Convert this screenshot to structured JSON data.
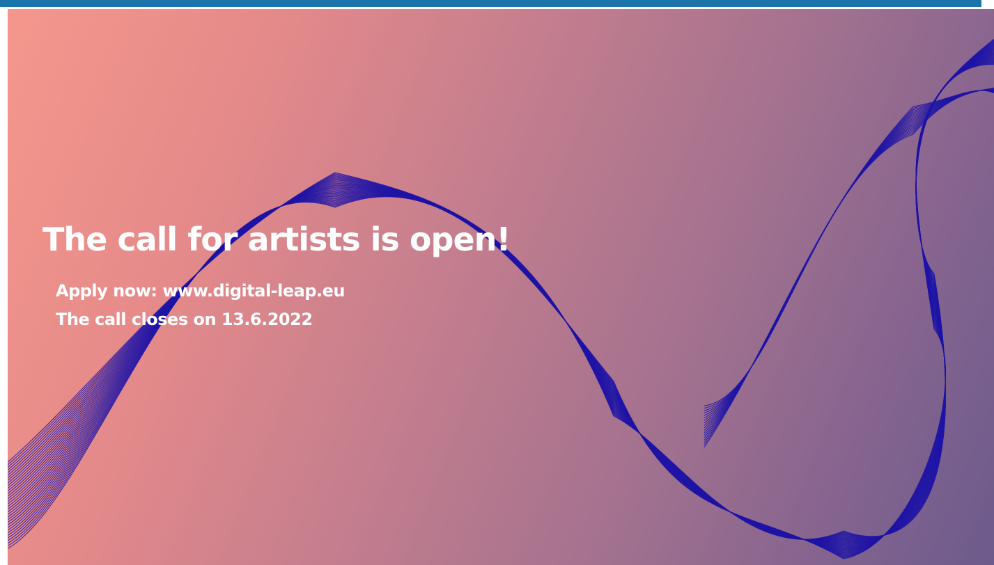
{
  "banner": {
    "headline": "The call for artists is open!",
    "apply_line": "Apply now: www.digital-leap.eu",
    "closing_line": "The call closes on 13.6.2022"
  },
  "colors": {
    "top_bar": "#1c75aa",
    "gradient_start": "#f5978c",
    "gradient_end": "#6c5b8c",
    "wave_lines": "#1f14a6",
    "text": "#ffffff"
  }
}
